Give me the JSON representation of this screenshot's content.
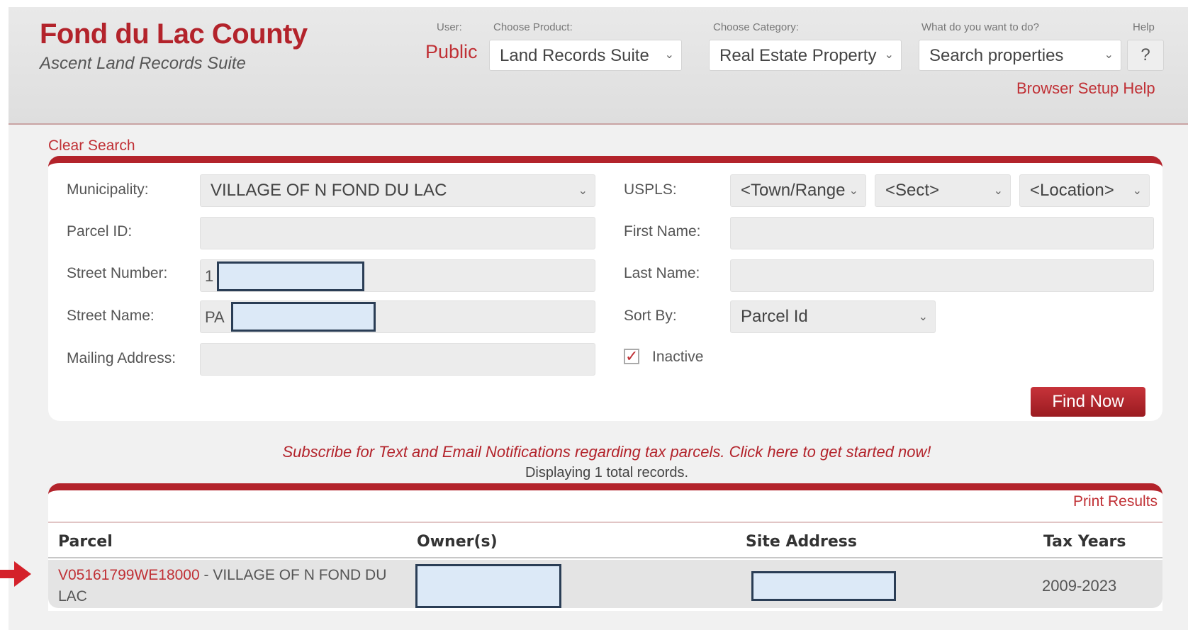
{
  "header": {
    "title": "Fond du Lac County",
    "subtitle": "Ascent Land Records Suite",
    "user_label": "User:",
    "user_value": "Public",
    "product_label": "Choose Product:",
    "product_value": "Land Records Suite",
    "category_label": "Choose Category:",
    "category_value": "Real Estate Property",
    "action_label": "What do you want to do?",
    "action_value": "Search properties",
    "help_label": "Help",
    "help_button": "?",
    "browser_help": "Browser Setup Help"
  },
  "search": {
    "clear": "Clear Search",
    "municipality_label": "Municipality:",
    "municipality_value": "VILLAGE OF N FOND DU LAC",
    "parcel_id_label": "Parcel ID:",
    "street_number_label": "Street Number:",
    "street_number_value": "1",
    "street_name_label": "Street Name:",
    "street_name_value": "PA",
    "mailing_label": "Mailing Address:",
    "usplss_label": "USPLS:",
    "town_range": "<Town/Range>",
    "sect": "<Sect>",
    "location": "<Location>",
    "first_name_label": "First Name:",
    "last_name_label": "Last Name:",
    "sort_by_label": "Sort By:",
    "sort_by_value": "Parcel Id",
    "inactive_label": "Inactive",
    "inactive_checked": "✓",
    "find_now": "Find Now"
  },
  "subscribe": "Subscribe for Text and Email Notifications regarding tax parcels. Click here to get started now!",
  "displaying": "Displaying 1 total records.",
  "results": {
    "print": "Print Results",
    "columns": [
      "Parcel",
      "Owner(s)",
      "Site Address",
      "Tax Years"
    ],
    "rows": [
      {
        "parcel_id": "V05161799WE18000",
        "parcel_desc": " - VILLAGE OF N FOND DU LAC",
        "tax_years": "2009-2023"
      }
    ]
  }
}
